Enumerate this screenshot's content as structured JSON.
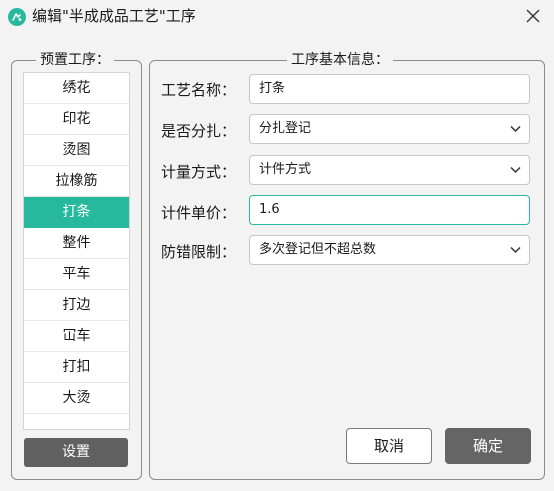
{
  "window": {
    "title": "编辑\"半成成品工艺\"工序",
    "app_icon": "app-logo-icon",
    "close_icon": "close-icon",
    "accent_color": "#27b99e"
  },
  "preset": {
    "legend": "预置工序：",
    "items": [
      "绣花",
      "印花",
      "烫图",
      "拉橡筋",
      "打条",
      "整件",
      "平车",
      "打边",
      "冚车",
      "打扣",
      "大烫"
    ],
    "selected": "打条",
    "settings_label": "设置"
  },
  "info": {
    "legend": "工序基本信息：",
    "process_name_label": "工艺名称：",
    "process_name_value": "打条",
    "bundle_label": "是否分扎：",
    "bundle_value": "分扎登记",
    "measure_label": "计量方式：",
    "measure_value": "计件方式",
    "unit_price_label": "计件单价：",
    "unit_price_value": "1.6",
    "error_limit_label": "防错限制：",
    "error_limit_value": "多次登记但不超总数"
  },
  "buttons": {
    "cancel": "取消",
    "confirm": "确定"
  }
}
